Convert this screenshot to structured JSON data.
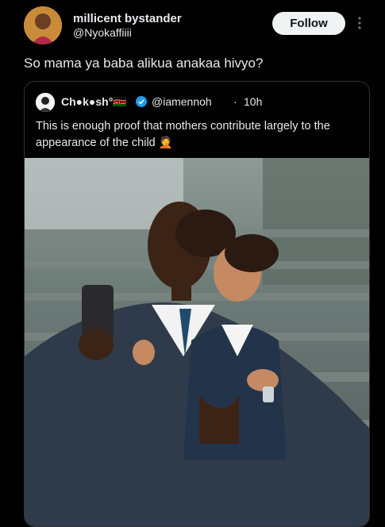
{
  "author": {
    "display_name": "millicent bystander",
    "handle": "@Nyokaffiiii",
    "follow_label": "Follow"
  },
  "tweet": {
    "text": "So mama ya baba alikua anakaa hivyo?"
  },
  "quoted": {
    "display_name": "Ch●k●sh°🇰🇪",
    "handle": "@iamennoh",
    "separator": "·",
    "time": "10h",
    "text": "This is enough proof that mothers contribute largely to the appearance of the child 🤦"
  },
  "colors": {
    "background": "#000000",
    "text": "#e7e9ea",
    "follow_bg": "#eff3f4",
    "verified": "#1d9bf0",
    "border": "#2f3336"
  }
}
